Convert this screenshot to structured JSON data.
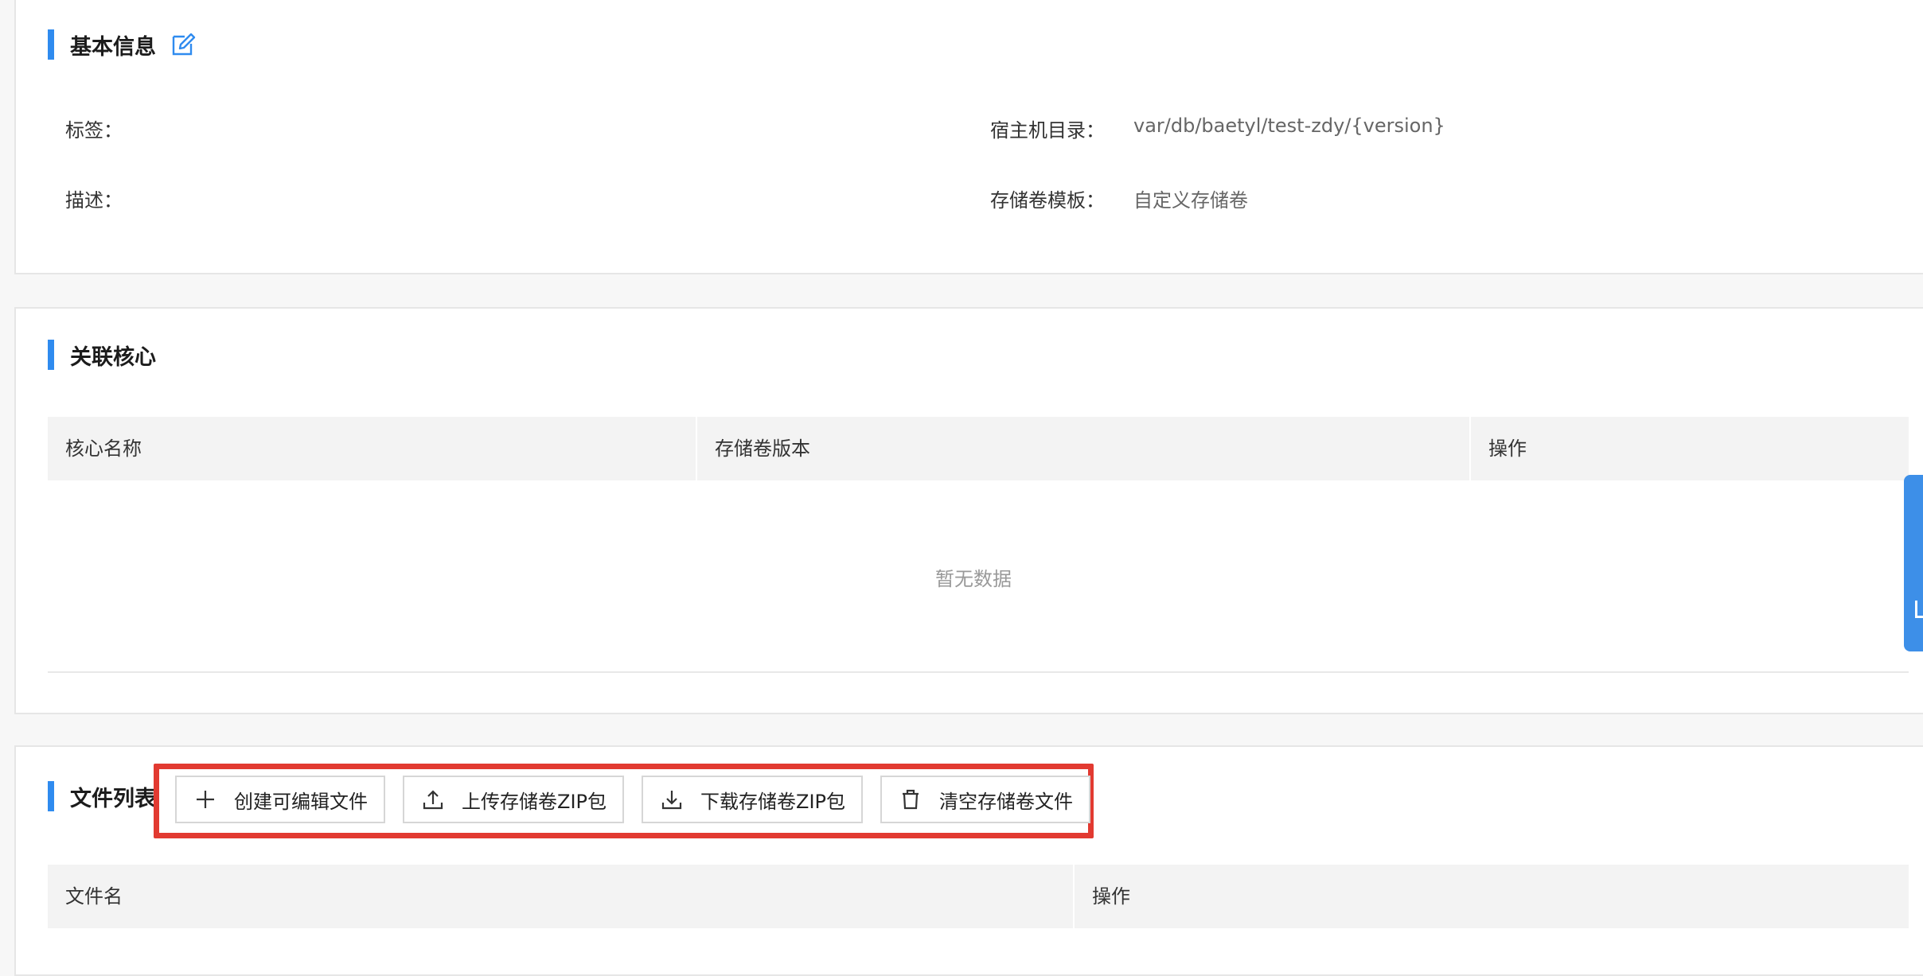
{
  "basic_info": {
    "title": "基本信息",
    "tags_label": "标签：",
    "tags_value": "",
    "desc_label": "描述：",
    "desc_value": "",
    "host_dir_label": "宿主机目录：",
    "host_dir_value": "var/db/baetyl/test-zdy/{version}",
    "template_label": "存储卷模板：",
    "template_value": "自定义存储卷"
  },
  "core": {
    "title": "关联核心",
    "columns": [
      "核心名称",
      "存储卷版本",
      "操作"
    ],
    "empty_text": "暂无数据"
  },
  "files": {
    "title": "文件列表",
    "toolbar": {
      "create_label": "创建可编辑文件",
      "upload_label": "上传存储卷ZIP包",
      "download_label": "下载存储卷ZIP包",
      "clear_label": "清空存储卷文件"
    },
    "columns": [
      "文件名",
      "操作"
    ]
  },
  "colors": {
    "accent": "#2f8bef",
    "highlight": "#e23a31",
    "header_bg": "#f3f3f3"
  },
  "icons": [
    "edit-icon",
    "plus-icon",
    "upload-icon",
    "download-icon",
    "trash-icon"
  ]
}
